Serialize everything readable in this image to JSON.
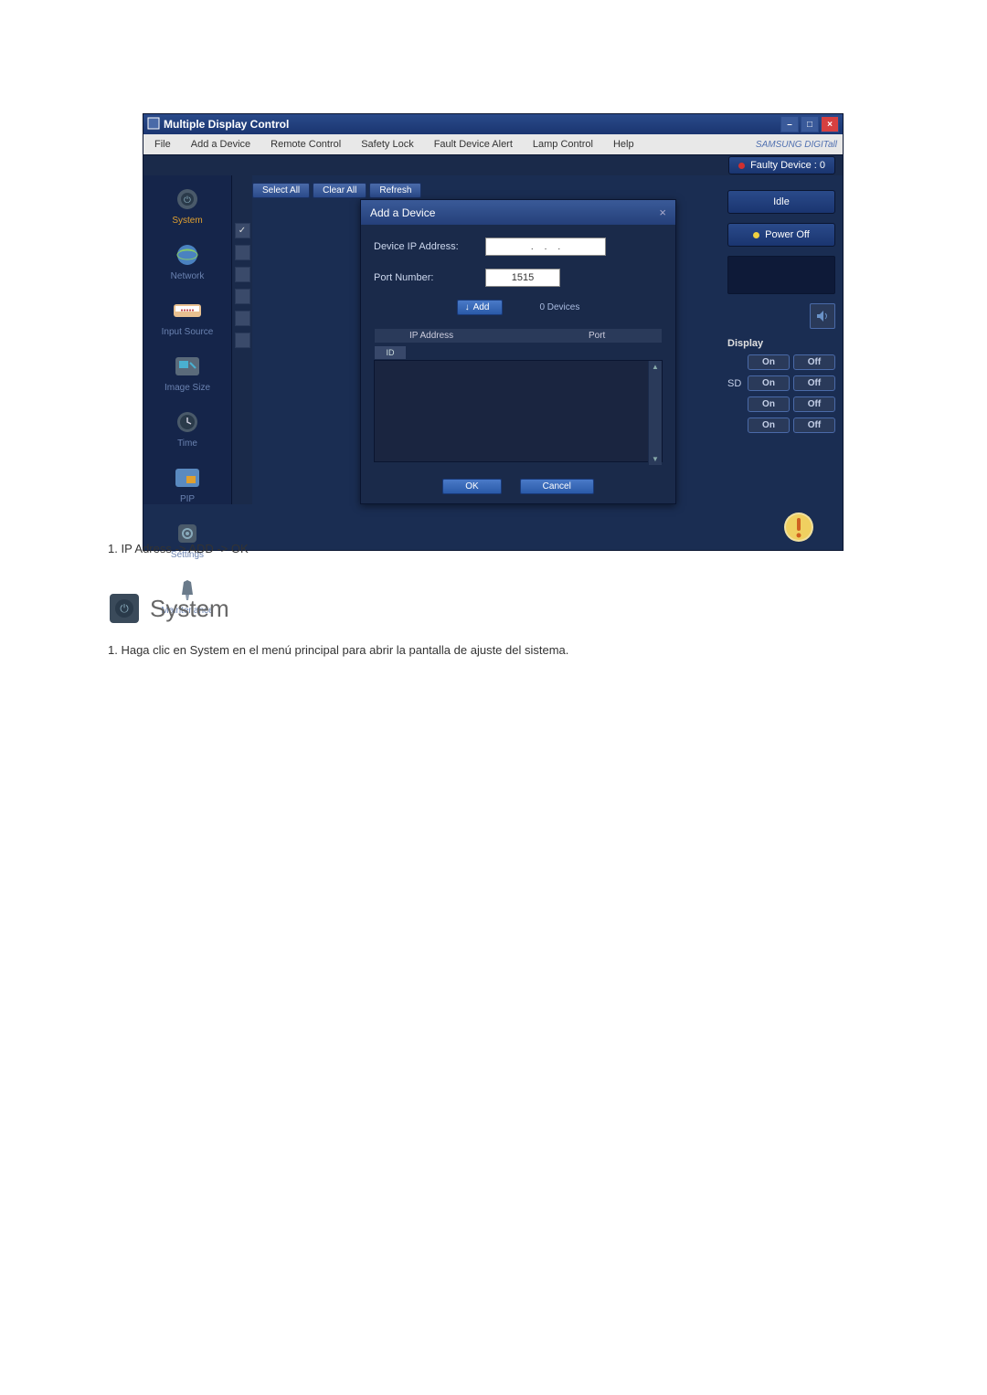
{
  "window": {
    "title": "Multiple Display Control",
    "brand": "SAMSUNG DIGITall"
  },
  "menu": {
    "file": "File",
    "add_device": "Add a Device",
    "remote_control": "Remote Control",
    "safety_lock": "Safety Lock",
    "fault_alert": "Fault Device Alert",
    "lamp_control": "Lamp Control",
    "help": "Help"
  },
  "status": {
    "faulty_label": "Faulty Device : 0"
  },
  "sidebar": {
    "items": [
      {
        "label": "System"
      },
      {
        "label": "Network"
      },
      {
        "label": "Input Source"
      },
      {
        "label": "Image Size"
      },
      {
        "label": "Time"
      },
      {
        "label": "PIP"
      },
      {
        "label": "Settings"
      },
      {
        "label": "Maintenance"
      }
    ]
  },
  "toolbar": {
    "select_all": "Select All",
    "clear_all": "Clear All",
    "refresh": "Refresh"
  },
  "right": {
    "idle": "Idle",
    "power_off": "Power Off",
    "display": "Display",
    "sd": "SD",
    "on": "On",
    "off": "Off"
  },
  "modal": {
    "title": "Add a Device",
    "ip_label": "Device IP Address:",
    "port_label": "Port Number:",
    "port_value": "1515",
    "add": "Add",
    "devices_count": "0 Devices",
    "col_id": "ID",
    "col_ip": "IP Address",
    "col_port": "Port",
    "ok": "OK",
    "cancel": "Cancel"
  },
  "instructions": {
    "step1": "1. IP Adress ->  ADD ->  OK",
    "heading": "System",
    "step2": "1. Haga clic en System en el menú principal para abrir la pantalla de ajuste del sistema."
  }
}
